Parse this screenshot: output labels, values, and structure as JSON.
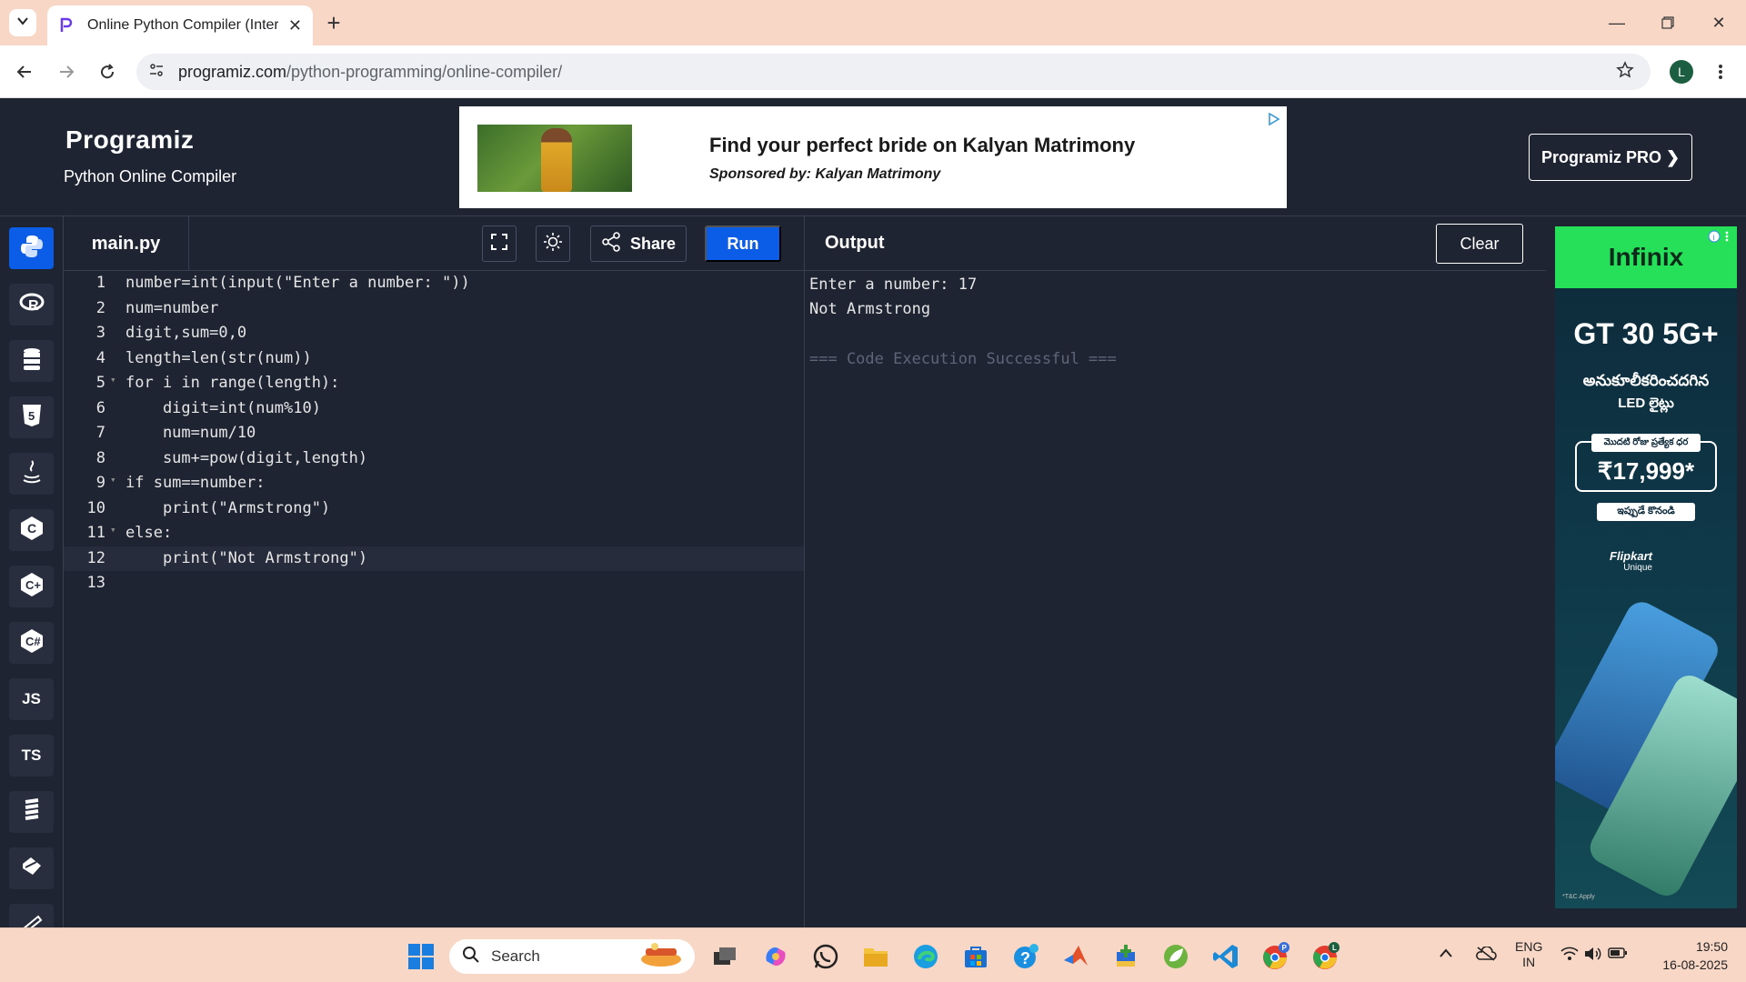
{
  "browser": {
    "tab_title": "Online Python Compiler (Interpreter)",
    "url_domain": "programiz.com",
    "url_path": "/python-programming/online-compiler/",
    "profile_initial": "L"
  },
  "site": {
    "logo": "Programiz",
    "subtitle": "Python Online Compiler",
    "pro_button": "Programiz PRO ❯"
  },
  "ad_banner": {
    "title": "Find your perfect bride on Kalyan Matrimony",
    "sponsor": "Sponsored by: Kalyan Matrimony"
  },
  "sidebar": {
    "languages": [
      {
        "name": "python-icon",
        "label": ""
      },
      {
        "name": "r-icon",
        "label": ""
      },
      {
        "name": "sql-icon",
        "label": ""
      },
      {
        "name": "html-icon",
        "label": ""
      },
      {
        "name": "java-icon",
        "label": ""
      },
      {
        "name": "c-icon",
        "label": ""
      },
      {
        "name": "cpp-icon",
        "label": ""
      },
      {
        "name": "csharp-icon",
        "label": ""
      },
      {
        "name": "js-icon",
        "label": "JS"
      },
      {
        "name": "ts-icon",
        "label": "TS"
      },
      {
        "name": "go-icon",
        "label": ""
      },
      {
        "name": "php-icon",
        "label": ""
      },
      {
        "name": "swift-icon",
        "label": ""
      }
    ]
  },
  "editor": {
    "filename": "main.py",
    "share_label": "Share",
    "run_label": "Run",
    "line_numbers": [
      "1",
      "2",
      "3",
      "4",
      "5",
      "6",
      "7",
      "8",
      "9",
      "10",
      "11",
      "12",
      "13"
    ],
    "code_lines": [
      "number=int(input(\"Enter a number: \"))",
      "num=number",
      "digit,sum=0,0",
      "length=len(str(num))",
      "for i in range(length):",
      "    digit=int(num%10)",
      "    num=num/10",
      "    sum+=pow(digit,length)",
      "if sum==number:",
      "    print(\"Armstrong\")",
      "else:",
      "    print(\"Not Armstrong\")",
      ""
    ]
  },
  "output": {
    "label": "Output",
    "clear_label": "Clear",
    "lines": [
      "Enter a number: 17",
      "Not Armstrong"
    ],
    "status": "=== Code Execution Successful ==="
  },
  "right_ad": {
    "brand": "Infinix",
    "model": "GT 30 5G+",
    "telugu_line1": "అనుకూలీకరించదగిన",
    "telugu_line2": "LED లైట్లు",
    "price_tag": "మొదటి రోజు ప్రత్యేక ధర",
    "price": "₹17,999*",
    "cta": "ఇప్పుడే కొనండి",
    "partner": "Flipkart",
    "partner_sub": "Unique",
    "tc": "*T&C Apply"
  },
  "taskbar": {
    "search_placeholder": "Search",
    "lang_line1": "ENG",
    "lang_line2": "IN",
    "time": "19:50",
    "date": "16-08-2025"
  }
}
